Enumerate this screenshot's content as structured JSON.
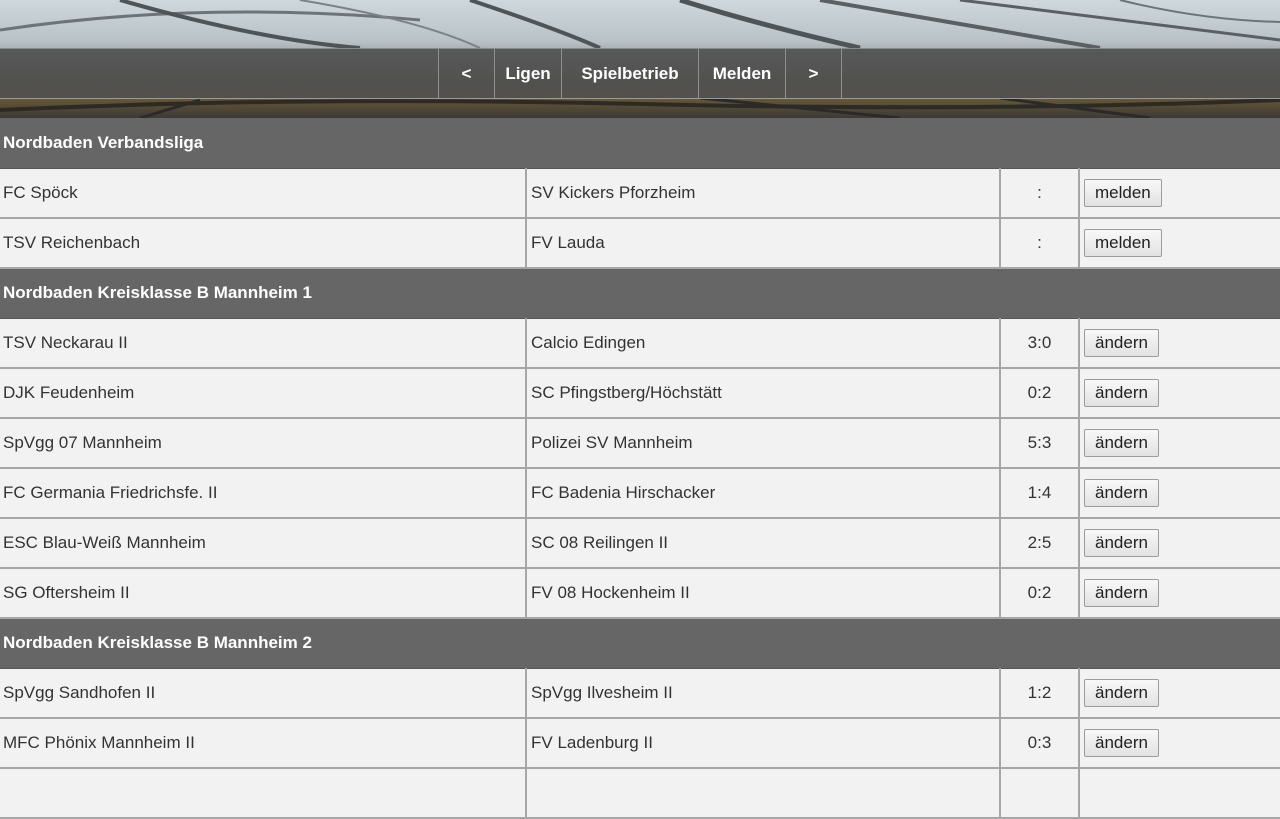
{
  "nav": {
    "prev": "<",
    "ligen": "Ligen",
    "spielbetrieb": "Spielbetrieb",
    "melden": "Melden",
    "next": ">"
  },
  "sections": [
    {
      "title": "Nordbaden Verbandsliga",
      "matches": [
        {
          "home": "FC Spöck",
          "away": "SV Kickers Pforzheim",
          "score": ":",
          "action": "melden"
        },
        {
          "home": "TSV Reichenbach",
          "away": "FV Lauda",
          "score": ":",
          "action": "melden"
        }
      ]
    },
    {
      "title": "Nordbaden Kreisklasse B Mannheim 1",
      "matches": [
        {
          "home": "TSV Neckarau II",
          "away": "Calcio Edingen",
          "score": "3:0",
          "action": "ändern"
        },
        {
          "home": "DJK Feudenheim",
          "away": "SC Pfingstberg/Höchstätt",
          "score": "0:2",
          "action": "ändern"
        },
        {
          "home": "SpVgg 07 Mannheim",
          "away": "Polizei SV Mannheim",
          "score": "5:3",
          "action": "ändern"
        },
        {
          "home": "FC Germania Friedrichsfe. II",
          "away": "FC Badenia Hirschacker",
          "score": "1:4",
          "action": "ändern"
        },
        {
          "home": "ESC Blau-Weiß Mannheim",
          "away": "SC 08 Reilingen II",
          "score": "2:5",
          "action": "ändern"
        },
        {
          "home": "SG Oftersheim II",
          "away": "FV 08 Hockenheim II",
          "score": "0:2",
          "action": "ändern"
        }
      ]
    },
    {
      "title": "Nordbaden Kreisklasse B Mannheim 2",
      "matches": [
        {
          "home": "SpVgg Sandhofen II",
          "away": "SpVgg Ilvesheim II",
          "score": "1:2",
          "action": "ändern"
        },
        {
          "home": "MFC Phönix Mannheim II",
          "away": "FV Ladenburg II",
          "score": "0:3",
          "action": "ändern"
        }
      ]
    }
  ]
}
